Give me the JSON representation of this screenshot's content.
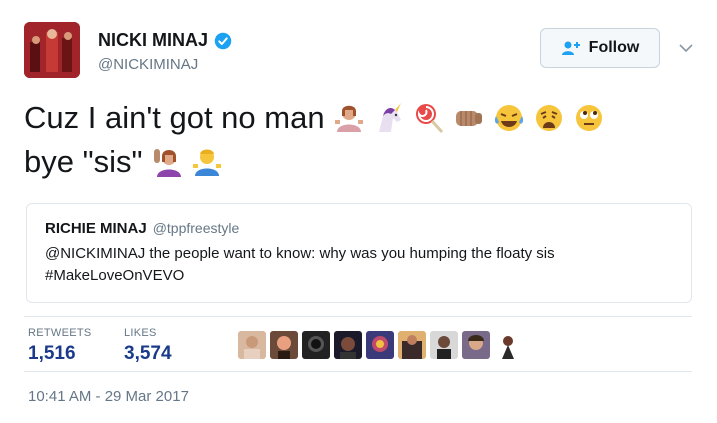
{
  "user": {
    "name": "NICKI MINAJ",
    "handle": "@NICKIMINAJ",
    "verified": true
  },
  "follow_button": {
    "label": "Follow",
    "icon": "add-user-icon"
  },
  "tweet": {
    "line1": "Cuz I ain't got no man",
    "line2": "bye \"sis\"",
    "emoji_line1": [
      "woman-shrugging",
      "unicorn",
      "lollipop",
      "fist-bump",
      "tears-of-joy",
      "weary-face",
      "rolling-eyes"
    ],
    "emoji_line2": [
      "woman-raising-hand",
      "man-shrugging"
    ]
  },
  "quote": {
    "name": "RICHIE MINAJ",
    "handle": "@tppfreestyle",
    "text": "@NICKIMINAJ the people want to know: why was you humping the floaty sis",
    "hashtag": "#MakeLoveOnVEVO"
  },
  "stats": {
    "retweets_label": "RETWEETS",
    "retweets_value": "1,516",
    "likes_label": "LIKES",
    "likes_value": "3,574"
  },
  "likers_count": 9,
  "timestamp": "10:41 AM - 29 Mar 2017",
  "colors": {
    "text": "#14171a",
    "muted": "#657786",
    "stat_value": "#1b3a8a",
    "verified": "#1da1f2",
    "border": "#e1e8ed"
  }
}
